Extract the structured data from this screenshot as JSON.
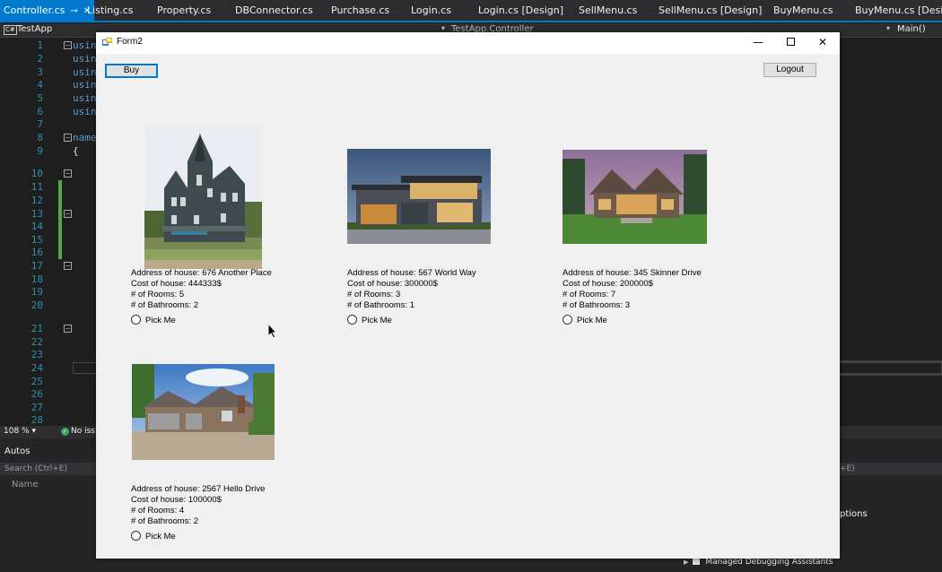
{
  "ide": {
    "tabs": [
      {
        "label": "Controller.cs",
        "active": true
      },
      {
        "label": "Listing.cs"
      },
      {
        "label": "Property.cs"
      },
      {
        "label": "DBConnector.cs"
      },
      {
        "label": "Purchase.cs"
      },
      {
        "label": "Login.cs"
      },
      {
        "label": "Login.cs [Design]"
      },
      {
        "label": "SellMenu.cs"
      },
      {
        "label": "SellMenu.cs [Design]"
      },
      {
        "label": "BuyMenu.cs"
      },
      {
        "label": "BuyMenu.cs [Design]"
      }
    ],
    "project": "TestApp",
    "class_nav": "TestApp.Controller",
    "method_nav": "Main()",
    "line_numbers": [
      "1",
      "2",
      "3",
      "4",
      "5",
      "6",
      "7",
      "8",
      "9",
      "10",
      "11",
      "12",
      "13",
      "14",
      "15",
      "16",
      "17",
      "18",
      "19",
      "20",
      "21",
      "22",
      "23",
      "24",
      "25",
      "26",
      "27",
      "28"
    ],
    "code_fragments": [
      "usin",
      "usin",
      "usin",
      "usin",
      "usin",
      "usin",
      "name",
      "{"
    ],
    "zoom": "108 %",
    "issues": "No iss",
    "autos_title": "Autos",
    "autos_search": "Search (Ctrl+E)",
    "autos_column": "Name",
    "right_search": "+E)",
    "right_options": "ptions",
    "managed_debugging": "Managed Debugging Assistants"
  },
  "form": {
    "title": "Form2",
    "buy_label": "Buy",
    "logout_label": "Logout",
    "pick_label": "Pick Me",
    "houses": [
      {
        "address": "Address of house: 676 Another Place",
        "cost": "Cost of house: 444333$",
        "rooms": "# of Rooms: 5",
        "bathrooms": "# of Bathrooms: 2"
      },
      {
        "address": "Address of house: 567 World Way",
        "cost": "Cost of house: 300000$",
        "rooms": "# of Rooms: 3",
        "bathrooms": "# of Bathrooms: 1"
      },
      {
        "address": "Address of house: 345 Skinner Drive",
        "cost": "Cost of house: 200000$",
        "rooms": "# of Rooms: 7",
        "bathrooms": "# of Bathrooms: 3"
      },
      {
        "address": "Address of house: 2567 Hello Drive",
        "cost": "Cost of house: 100000$",
        "rooms": "# of Rooms: 4",
        "bathrooms": "# of Bathrooms: 2"
      }
    ]
  }
}
